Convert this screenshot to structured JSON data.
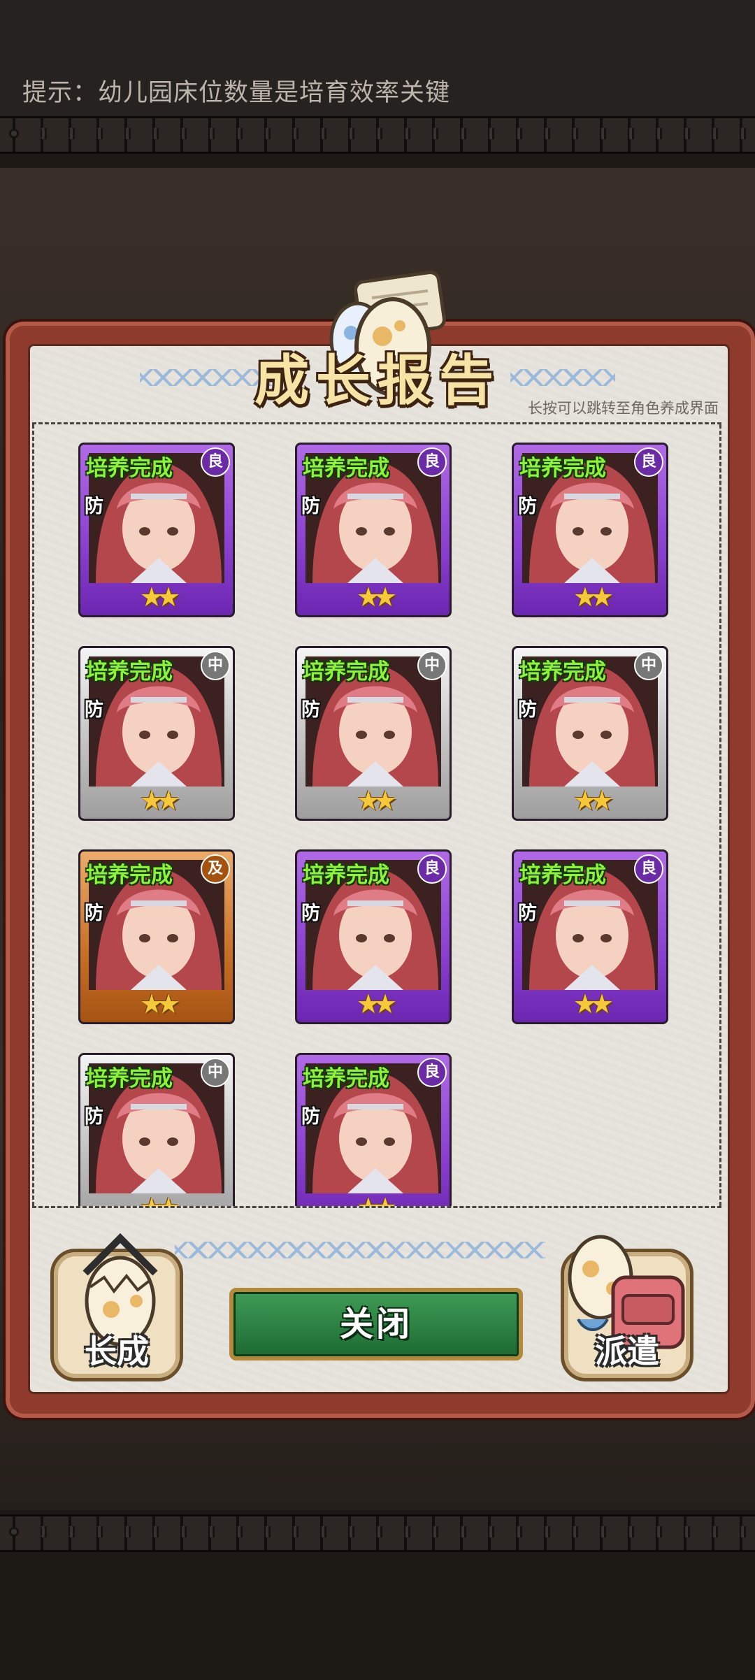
{
  "tip_text": "提示：幼儿园床位数量是培育效率关键",
  "panel": {
    "title": "成长报告",
    "hint": "长按可以跳转至角色养成界面"
  },
  "cards": [
    {
      "status": "培养完成",
      "role": "防",
      "grade": "良",
      "stars": "★★"
    },
    {
      "status": "培养完成",
      "role": "防",
      "grade": "良",
      "stars": "★★"
    },
    {
      "status": "培养完成",
      "role": "防",
      "grade": "良",
      "stars": "★★"
    },
    {
      "status": "培养完成",
      "role": "防",
      "grade": "中",
      "stars": "★★"
    },
    {
      "status": "培养完成",
      "role": "防",
      "grade": "中",
      "stars": "★★"
    },
    {
      "status": "培养完成",
      "role": "防",
      "grade": "中",
      "stars": "★★"
    },
    {
      "status": "培养完成",
      "role": "防",
      "grade": "及",
      "stars": "★★"
    },
    {
      "status": "培养完成",
      "role": "防",
      "grade": "良",
      "stars": "★★"
    },
    {
      "status": "培养完成",
      "role": "防",
      "grade": "良",
      "stars": "★★"
    },
    {
      "status": "培养完成",
      "role": "防",
      "grade": "中",
      "stars": "★★"
    },
    {
      "status": "培养完成",
      "role": "防",
      "grade": "良",
      "stars": "★★"
    }
  ],
  "buttons": {
    "grow": "长成",
    "close": "关闭",
    "dispatch": "派遣"
  },
  "colors": {
    "grade_good": "#8a3fd0",
    "grade_mid": "#bfbfbf",
    "grade_pass": "#c86e25",
    "status_text": "#8ef23a"
  }
}
